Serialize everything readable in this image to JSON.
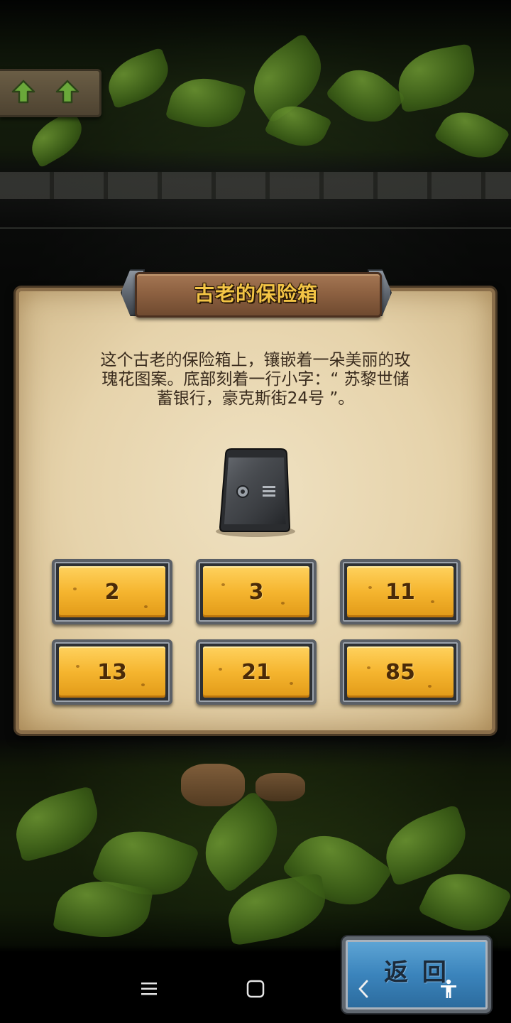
{
  "dialog": {
    "title": "古老的保险箱",
    "description": "这个古老的保险箱上，镶嵌着一朵美丽的玫\n瑰花图案。底部刻着一行小字：“ 苏黎世储\n蓄银行，豪克斯街24号 ”。"
  },
  "answers": [
    "2",
    "3",
    "11",
    "13",
    "21",
    "85"
  ],
  "back_button": {
    "label": "返 回"
  },
  "nav_panel": {
    "icons": [
      "up-arrow-icon",
      "up-arrow-icon"
    ]
  },
  "system_nav": {
    "icons": [
      "menu-icon",
      "home-icon",
      "back-chevron-icon",
      "accessibility-icon"
    ]
  },
  "colors": {
    "title_gold": "#f3c445",
    "answer_gold": "#f5b52f",
    "back_blue": "#3b84bc",
    "parchment": "#e6d3ab"
  }
}
